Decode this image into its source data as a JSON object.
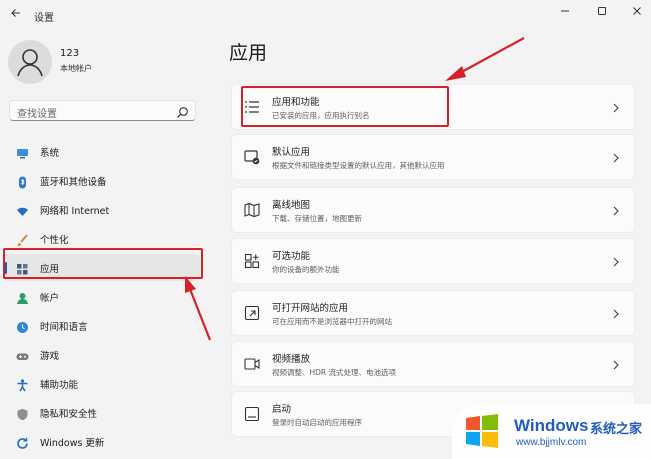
{
  "window": {
    "title": "设置",
    "back_icon": "back-arrow-icon",
    "minimize_icon": "minimize-icon",
    "maximize_icon": "maximize-icon",
    "close_icon": "close-icon"
  },
  "user": {
    "name": "123",
    "account_type": "本地帐户"
  },
  "search": {
    "placeholder": "查找设置"
  },
  "sidebar": {
    "items": [
      {
        "label": "系统",
        "icon": "monitor-icon",
        "active": false
      },
      {
        "label": "蓝牙和其他设备",
        "icon": "bluetooth-icon",
        "active": false
      },
      {
        "label": "网络和 Internet",
        "icon": "wifi-icon",
        "active": false
      },
      {
        "label": "个性化",
        "icon": "brush-icon",
        "active": false
      },
      {
        "label": "应用",
        "icon": "apps-icon",
        "active": true
      },
      {
        "label": "帐户",
        "icon": "person-icon",
        "active": false
      },
      {
        "label": "时间和语言",
        "icon": "globe-clock-icon",
        "active": false
      },
      {
        "label": "游戏",
        "icon": "gamepad-icon",
        "active": false
      },
      {
        "label": "辅助功能",
        "icon": "accessibility-icon",
        "active": false
      },
      {
        "label": "隐私和安全性",
        "icon": "shield-icon",
        "active": false
      },
      {
        "label": "Windows 更新",
        "icon": "update-icon",
        "active": false
      }
    ]
  },
  "main": {
    "title": "应用",
    "cards": [
      {
        "title": "应用和功能",
        "subtitle": "已安装的应用，应用执行别名",
        "icon": "apps-list-icon"
      },
      {
        "title": "默认应用",
        "subtitle": "根据文件和链接类型设置的默认应用，其他默认应用",
        "icon": "default-apps-icon"
      },
      {
        "title": "离线地图",
        "subtitle": "下载、存储位置，地图更新",
        "icon": "map-icon"
      },
      {
        "title": "可选功能",
        "subtitle": "你的设备的额外功能",
        "icon": "optional-features-icon"
      },
      {
        "title": "可打开网站的应用",
        "subtitle": "可在应用而不是浏览器中打开的网站",
        "icon": "website-apps-icon"
      },
      {
        "title": "视频播放",
        "subtitle": "视频调整、HDR 流式处理、电池选项",
        "icon": "video-icon"
      },
      {
        "title": "启动",
        "subtitle": "登录时自动启动的应用程序",
        "icon": "startup-icon"
      }
    ]
  },
  "watermark": {
    "brand": "Windows",
    "cn": "系统之家",
    "url": "www.bjjmlv.com"
  },
  "colors": {
    "accent": "#0067c0",
    "highlight": "#d8202a",
    "background": "#f3f3f3",
    "card": "#fbfbfb"
  }
}
